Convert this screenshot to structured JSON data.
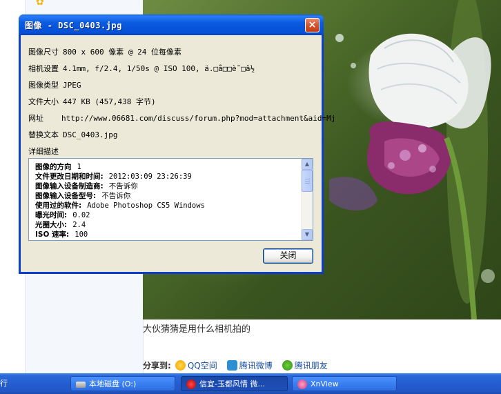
{
  "background": {
    "caption": "大伙猜猜是用什么相机拍的",
    "share": {
      "label": "分享到:",
      "items": [
        {
          "label": "QQ空间",
          "icon": "qzone-icon"
        },
        {
          "label": "腾讯微博",
          "icon": "tencent-weibo-icon"
        },
        {
          "label": "腾讯朋友",
          "icon": "clover-icon"
        }
      ]
    }
  },
  "dialog": {
    "title": "图像 - DSC_0403.jpg",
    "close_glyph": "×",
    "rows": {
      "dimensions": {
        "label": "图像尺寸",
        "value": "800 x 600 像素 @ 24 位每像素"
      },
      "camera": {
        "label": "相机设置",
        "value": "4.1mm, f/2.4, 1/50s @ ISO 100, ä.□å□□è˜□â½"
      },
      "type": {
        "label": "图像类型",
        "value": "JPEG"
      },
      "filesize": {
        "label": "文件大小",
        "value": "447 KB (457,438 字节)"
      },
      "url": {
        "label": "网址",
        "value": "http://www.06681.com/discuss/forum.php?mod=attachment&aid=Mj"
      },
      "alt": {
        "label": "替换文本",
        "value": "DSC_0403.jpg"
      },
      "detail": {
        "label": "详细描述"
      }
    },
    "details": [
      {
        "key": "图像的方向",
        "value": "1"
      },
      {
        "key": "文件更改日期和时间:",
        "value": "2012:03:09 23:26:39"
      },
      {
        "key": "图像输入设备制造商:",
        "value": "不告诉你"
      },
      {
        "key": "图像输入设备型号:",
        "value": "不告诉你"
      },
      {
        "key": "使用过的软件:",
        "value": "Adobe Photoshop CS5 Windows"
      },
      {
        "key": "曝光时间:",
        "value": "0.02"
      },
      {
        "key": "光圈大小:",
        "value": "2.4"
      },
      {
        "key": "ISO 速率:",
        "value": "100"
      }
    ],
    "ok_label": "关闭"
  },
  "taskbar": {
    "left_fragment": "行",
    "items": [
      {
        "label": "本地磁盘 (O:)",
        "icon": "drive-icon"
      },
      {
        "label": "信宜-玉都风情 微...",
        "icon": "opera-icon"
      },
      {
        "label": "XnView",
        "icon": "xnview-icon"
      }
    ]
  }
}
